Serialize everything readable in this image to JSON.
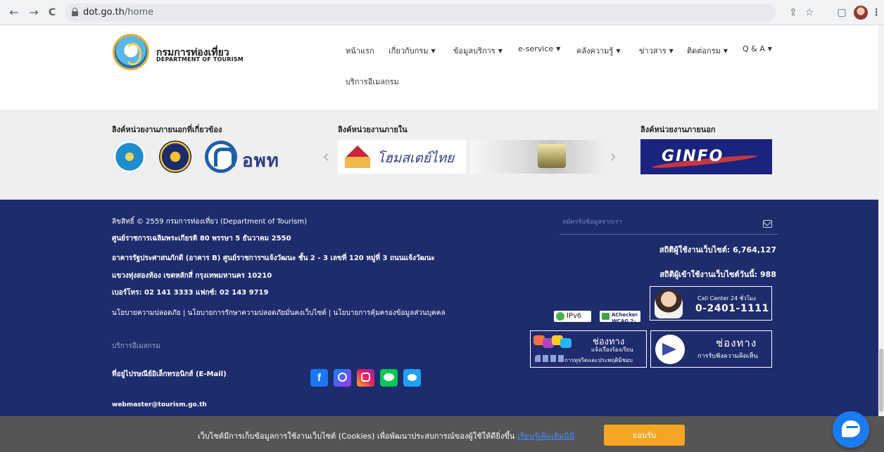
{
  "browser": {
    "url_host": "dot.go.th",
    "url_path": "/home",
    "back": "←",
    "forward": "→",
    "reload": "C",
    "share": "⇪",
    "star": "☆",
    "tabs": "▢",
    "menu": "⋮"
  },
  "header": {
    "logo_th": "กรมการท่องเที่ยว",
    "logo_en": "DEPARTMENT OF TOURISM",
    "menu": [
      {
        "label": "หน้าแรก",
        "dropdown": false
      },
      {
        "label": "เกี่ยวกับกรม",
        "dropdown": true
      },
      {
        "label": "ข้อมูลบริการ",
        "dropdown": true
      },
      {
        "label": "e-service",
        "dropdown": true
      },
      {
        "label": "คลังความรู้",
        "dropdown": true
      },
      {
        "label": "ข่าวสาร",
        "dropdown": true
      },
      {
        "label": "ติดต่อกรม",
        "dropdown": true
      },
      {
        "label": "Q & A",
        "dropdown": true
      }
    ],
    "menu_row2": "บริการอีเมลกรม",
    "caret": "▼"
  },
  "links": {
    "external_related_title": "ลิงค์หน่วยงานภายนอกที่เกี่ยวข้อง",
    "internal_title": "ลิงค์หน่วยงานภายใน",
    "external_title": "ลิงค์หน่วยงานภายนอก",
    "awn_logo": "อพท",
    "homestay_text": "โฮมสเตย์ไทย",
    "homestay_mark": "Home Stay",
    "ginfo_text": "GINFO",
    "prev": "‹",
    "next": "›"
  },
  "footer": {
    "copyright": "ลิขสิทธิ์ © 2559 กรมการท่องเที่ยว (Department of Tourism)",
    "address1": "ศูนย์ราชการเฉลิมพระเกียรติ 80 พรรษา 5 ธันวาคม 2550",
    "address2": "อาคารรัฐประศาสนภักดี (อาคาร B) ศูนย์ราชการฯแจ้งวัฒนะ ชั้น 2 - 3 เลขที่ 120 หมู่ที่ 3 ถนนแจ้งวัฒนะ",
    "address3": "แขวงทุ่งสองห้อง เขตหลักสี่ กรุงเทพมหานคร 10210",
    "phone": "เบอร์โทร: 02 141 3333 แฟกซ์: 02 143 9719",
    "policies": "นโยบายความปลอดภัย | นโยบายการรักษาความปลอดภัยมั่นคงเว็บไซต์ | นโยบายการคุ้มครองข้อมูลส่วนบุคคล",
    "email_service": "บริการอีเมลกรม",
    "email_label": "ที่อยู่ไปรษณีย์อิเล็กทรอนิกส์ (E-Mail)",
    "email": "webmaster@tourism.go.th",
    "subscribe_placeholder": "สมัครรับข้อมูลจากเรา",
    "stat_visitors": "สถิติผู้ใช้งานเว็บไซต์: 6,764,127",
    "stat_today": "สถิติผู้เข้าใช้งานเว็บไซต์วันนี้: 988",
    "call_label": "Call Center 24 ชั่วโมง",
    "call_number": "0-2401-1111",
    "ipv6": "IPv6",
    "achecker": "AChecker WCAG 2-AA",
    "channel1_title": "ช่องทาง",
    "channel1_sub": "แจ้งเรื่องร้องเรียน",
    "channel1_sub2": "การทุจริตและประพฤติมิชอบ",
    "channel2_title": "ช่องทาง",
    "channel2_sub": "การรับฟังความคิดเห็น",
    "social": {
      "facebook": "f"
    }
  },
  "cookie": {
    "text": "เว็บไซต์มีการเก็บข้อมูลการใช้งานเว็บไซต์ (Cookies) เพื่อพัฒนาประสบการณ์ของผู้ใช้ให้ดียิ่งขึ้น",
    "link": "เรียนรู้เพิ่มเติมนี่นี่",
    "accept": "ยอมรับ"
  }
}
